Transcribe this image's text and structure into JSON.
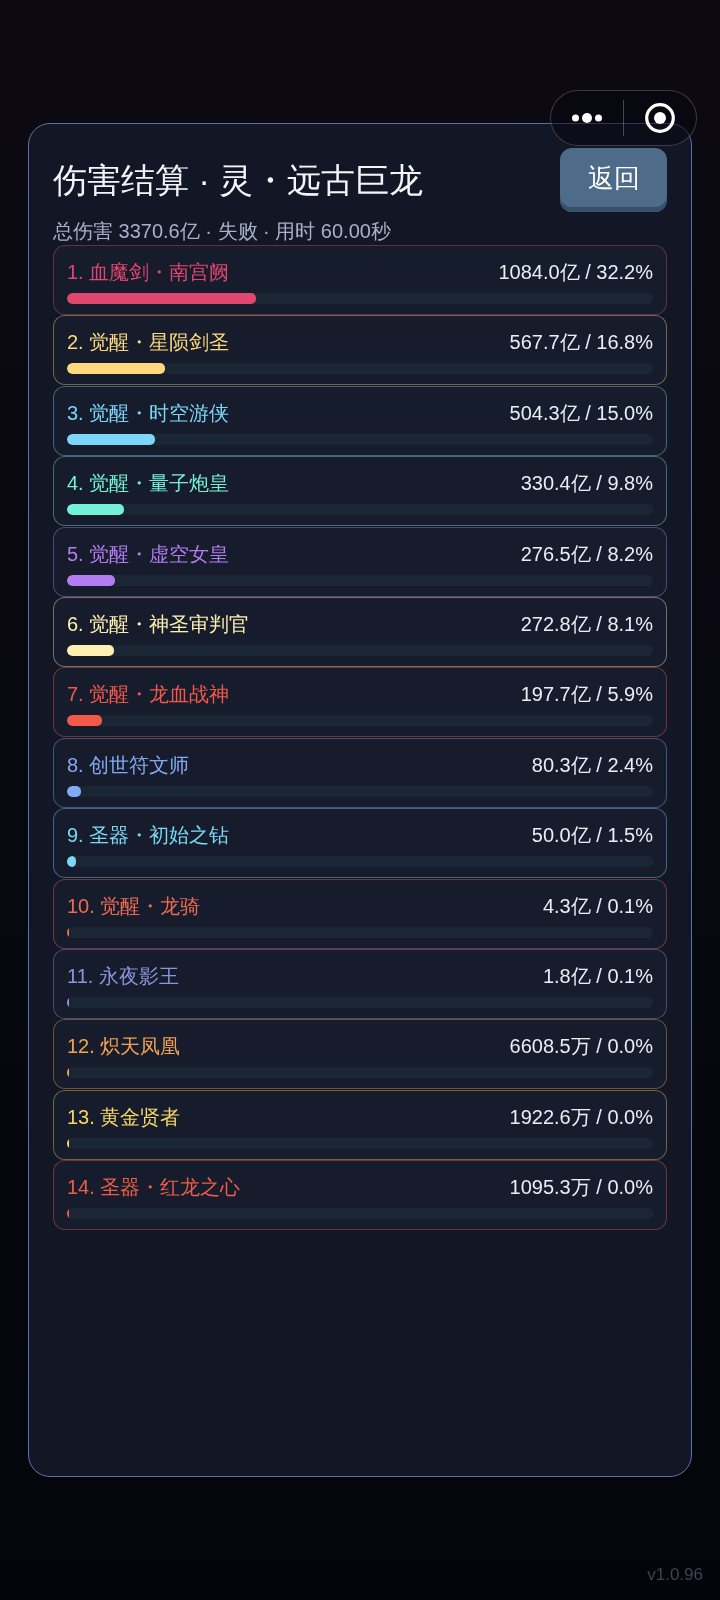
{
  "dialog": {
    "title": "伤害结算 · 灵・远古巨龙",
    "back_button": "返回",
    "summary": "总伤害 3370.6亿 · 失败 · 用时 60.00秒",
    "rows": [
      {
        "name": "1. 血魔剑・南宫阙",
        "value": "1084.0亿 / 32.2%",
        "level": 0.322,
        "color": "#e0476e"
      },
      {
        "name": "2. 觉醒・星陨剑圣",
        "value": "567.7亿 / 16.8%",
        "level": 0.168,
        "color": "#fcd97c"
      },
      {
        "name": "3. 觉醒・时空游侠",
        "value": "504.3亿 / 15.0%",
        "level": 0.15,
        "color": "#7dd5fa"
      },
      {
        "name": "4. 觉醒・量子炮皇",
        "value": "330.4亿 / 9.8%",
        "level": 0.098,
        "color": "#72f0d8"
      },
      {
        "name": "5. 觉醒・虚空女皇",
        "value": "276.5亿 / 8.2%",
        "level": 0.082,
        "color": "#b47cf2"
      },
      {
        "name": "6. 觉醒・神圣审判官",
        "value": "272.8亿 / 8.1%",
        "level": 0.081,
        "color": "#fdf0b0"
      },
      {
        "name": "7. 觉醒・龙血战神",
        "value": "197.7亿 / 5.9%",
        "level": 0.059,
        "color": "#f2594b"
      },
      {
        "name": "8. 创世符文师",
        "value": "80.3亿 / 2.4%",
        "level": 0.024,
        "color": "#82aaf2"
      },
      {
        "name": "9. 圣器・初始之钻",
        "value": "50.0亿 / 1.5%",
        "level": 0.015,
        "color": "#7ad8f5"
      },
      {
        "name": "10. 觉醒・龙骑",
        "value": "4.3亿 / 0.1%",
        "level": 0.0013,
        "color": "#f06a52"
      },
      {
        "name": "11. 永夜影王",
        "value": "1.8亿 / 0.1%",
        "level": 0.0005,
        "color": "#8e94dc"
      },
      {
        "name": "12. 炽天凤凰",
        "value": "6608.5万 / 0.0%",
        "level": 0.0002,
        "color": "#f2a452"
      },
      {
        "name": "13. 黄金贤者",
        "value": "1922.6万 / 0.0%",
        "level": 0.0001,
        "color": "#f5d865"
      },
      {
        "name": "14. 圣器・红龙之心",
        "value": "1095.3万 / 0.0%",
        "level": 0.0001,
        "color": "#f05c4a"
      }
    ]
  },
  "version": "v1.0.96"
}
